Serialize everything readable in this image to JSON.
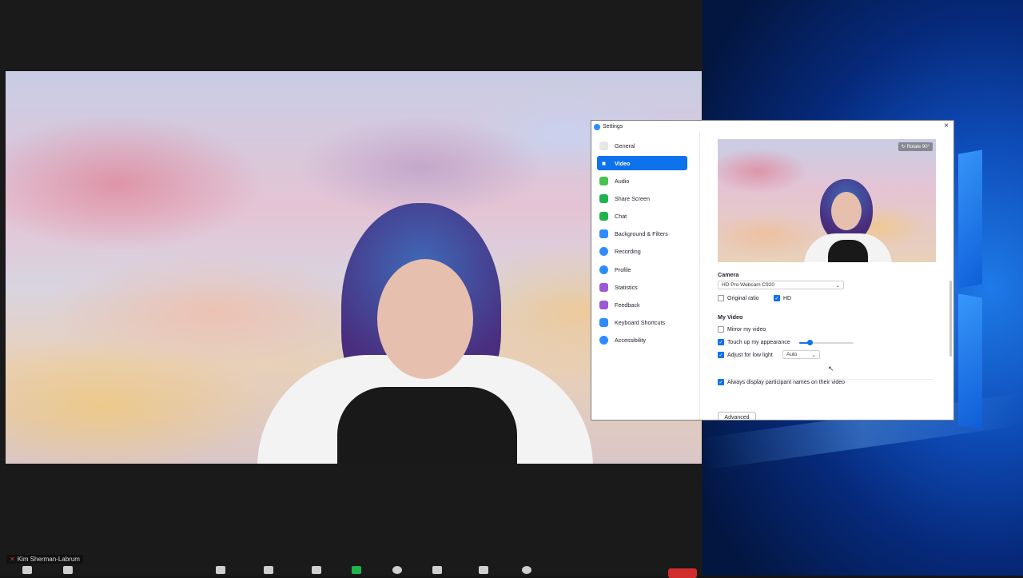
{
  "zoom": {
    "participant_name": "Kim Sherman-Labrum"
  },
  "settings": {
    "title": "Settings",
    "close": "×",
    "nav": [
      {
        "label": "General",
        "icon": "gear-icon",
        "color": "#e6e6e6"
      },
      {
        "label": "Video",
        "icon": "video-camera-icon",
        "color": "#ffffff",
        "active": true
      },
      {
        "label": "Audio",
        "icon": "headphones-icon",
        "color": "#47c34d"
      },
      {
        "label": "Share Screen",
        "icon": "share-screen-icon",
        "color": "#1fb34b"
      },
      {
        "label": "Chat",
        "icon": "chat-bubble-icon",
        "color": "#1fb34b"
      },
      {
        "label": "Background & Filters",
        "icon": "person-background-icon",
        "color": "#2d8cff"
      },
      {
        "label": "Recording",
        "icon": "record-icon",
        "color": "#2d8cff"
      },
      {
        "label": "Profile",
        "icon": "profile-icon",
        "color": "#2d8cff"
      },
      {
        "label": "Statistics",
        "icon": "bar-stats-icon",
        "color": "#9b59d6"
      },
      {
        "label": "Feedback",
        "icon": "smiley-feedback-icon",
        "color": "#9b59d6"
      },
      {
        "label": "Keyboard Shortcuts",
        "icon": "keyboard-icon",
        "color": "#2d8cff"
      },
      {
        "label": "Accessibility",
        "icon": "accessibility-icon",
        "color": "#2d8cff"
      }
    ],
    "video": {
      "rotate_label": "Rotate 90°",
      "camera_heading": "Camera",
      "camera_value": "HD Pro Webcam C920",
      "original_ratio_label": "Original ratio",
      "original_ratio_checked": false,
      "hd_label": "HD",
      "hd_checked": true,
      "my_video_heading": "My Video",
      "mirror_label": "Mirror my video",
      "mirror_checked": false,
      "touch_up_label": "Touch up my appearance",
      "touch_up_checked": true,
      "touch_up_level": 0.2,
      "low_light_label": "Adjust for low light",
      "low_light_checked": true,
      "low_light_value": "Auto",
      "participant_names_label": "Always display participant names on their video",
      "participant_names_checked": true,
      "advanced_label": "Advanced"
    }
  },
  "colors": {
    "accent": "#0e72ed",
    "end_button": "#d32c2c"
  }
}
